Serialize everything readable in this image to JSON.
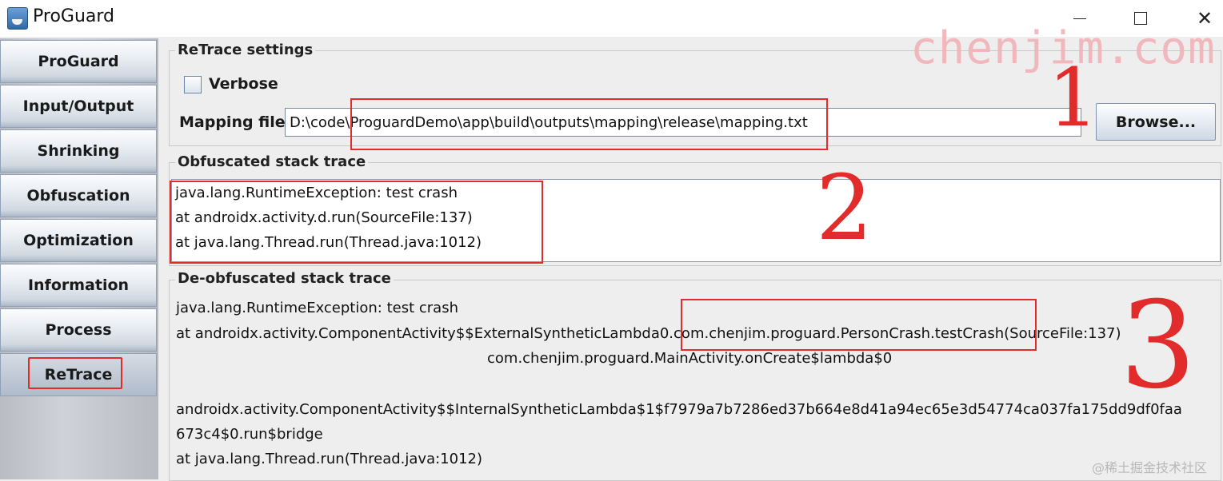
{
  "window": {
    "title": "ProGuard",
    "icon": "java-cup-icon"
  },
  "sidebar": {
    "items": [
      {
        "label": "ProGuard"
      },
      {
        "label": "Input/Output"
      },
      {
        "label": "Shrinking"
      },
      {
        "label": "Obfuscation"
      },
      {
        "label": "Optimization"
      },
      {
        "label": "Information"
      },
      {
        "label": "Process"
      },
      {
        "label": "ReTrace"
      }
    ],
    "active": "ReTrace"
  },
  "retrace_settings": {
    "title": "ReTrace settings",
    "verbose_label": "Verbose",
    "verbose_checked": false,
    "mapping_label": "Mapping file",
    "mapping_value": "D:\\code\\ProguardDemo\\app\\build\\outputs\\mapping\\release\\mapping.txt",
    "browse_label": "Browse..."
  },
  "obfuscated": {
    "title": "Obfuscated stack trace",
    "lines": [
      "java.lang.RuntimeException: test crash",
      "at androidx.activity.d.run(SourceFile:137)",
      "at java.lang.Thread.run(Thread.java:1012)"
    ]
  },
  "deobfuscated": {
    "title": "De-obfuscated stack trace",
    "lines": [
      "java.lang.RuntimeException: test crash",
      "at androidx.activity.ComponentActivity$$ExternalSyntheticLambda0.com.chenjim.proguard.PersonCrash.testCrash(SourceFile:137)",
      "com.chenjim.proguard.MainActivity.onCreate$lambda$0",
      "androidx.activity.ComponentActivity$$InternalSyntheticLambda$1$f7979a7b7286ed37b664e8d41a94ec65e3d54774ca037fa175dd9df0faa",
      "673c4$0.run$bridge",
      "at java.lang.Thread.run(Thread.java:1012)"
    ]
  },
  "annotations": {
    "watermark": "chenjim.com",
    "marks": [
      "1",
      "2",
      "3"
    ],
    "site_mark": "@稀土掘金技术社区",
    "color": "#e22b2b"
  }
}
